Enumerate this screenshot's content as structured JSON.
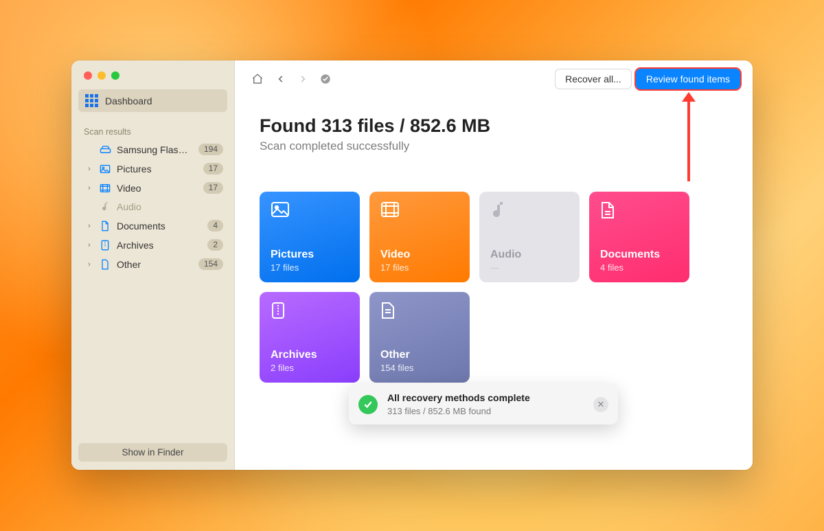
{
  "sidebar": {
    "dashboard_label": "Dashboard",
    "section_label": "Scan results",
    "items": [
      {
        "label": "Samsung Flash D...",
        "count": "194",
        "icon": "drive",
        "expandable": false
      },
      {
        "label": "Pictures",
        "count": "17",
        "icon": "picture",
        "expandable": true
      },
      {
        "label": "Video",
        "count": "17",
        "icon": "video",
        "expandable": true
      },
      {
        "label": "Audio",
        "count": "",
        "icon": "audio",
        "expandable": false
      },
      {
        "label": "Documents",
        "count": "4",
        "icon": "doc",
        "expandable": true
      },
      {
        "label": "Archives",
        "count": "2",
        "icon": "archive",
        "expandable": true
      },
      {
        "label": "Other",
        "count": "154",
        "icon": "other",
        "expandable": true
      }
    ],
    "finder_label": "Show in Finder"
  },
  "toolbar": {
    "recover_label": "Recover all...",
    "review_label": "Review found items"
  },
  "headline": {
    "title": "Found 313 files / 852.6 MB",
    "subtitle": "Scan completed successfully"
  },
  "cards": [
    {
      "kind": "pictures",
      "title": "Pictures",
      "sub": "17 files"
    },
    {
      "kind": "video",
      "title": "Video",
      "sub": "17 files"
    },
    {
      "kind": "audio",
      "title": "Audio",
      "sub": "—"
    },
    {
      "kind": "documents",
      "title": "Documents",
      "sub": "4 files"
    },
    {
      "kind": "archives",
      "title": "Archives",
      "sub": "2 files"
    },
    {
      "kind": "other",
      "title": "Other",
      "sub": "154 files"
    }
  ],
  "toast": {
    "title": "All recovery methods complete",
    "subtitle": "313 files / 852.6 MB found"
  }
}
